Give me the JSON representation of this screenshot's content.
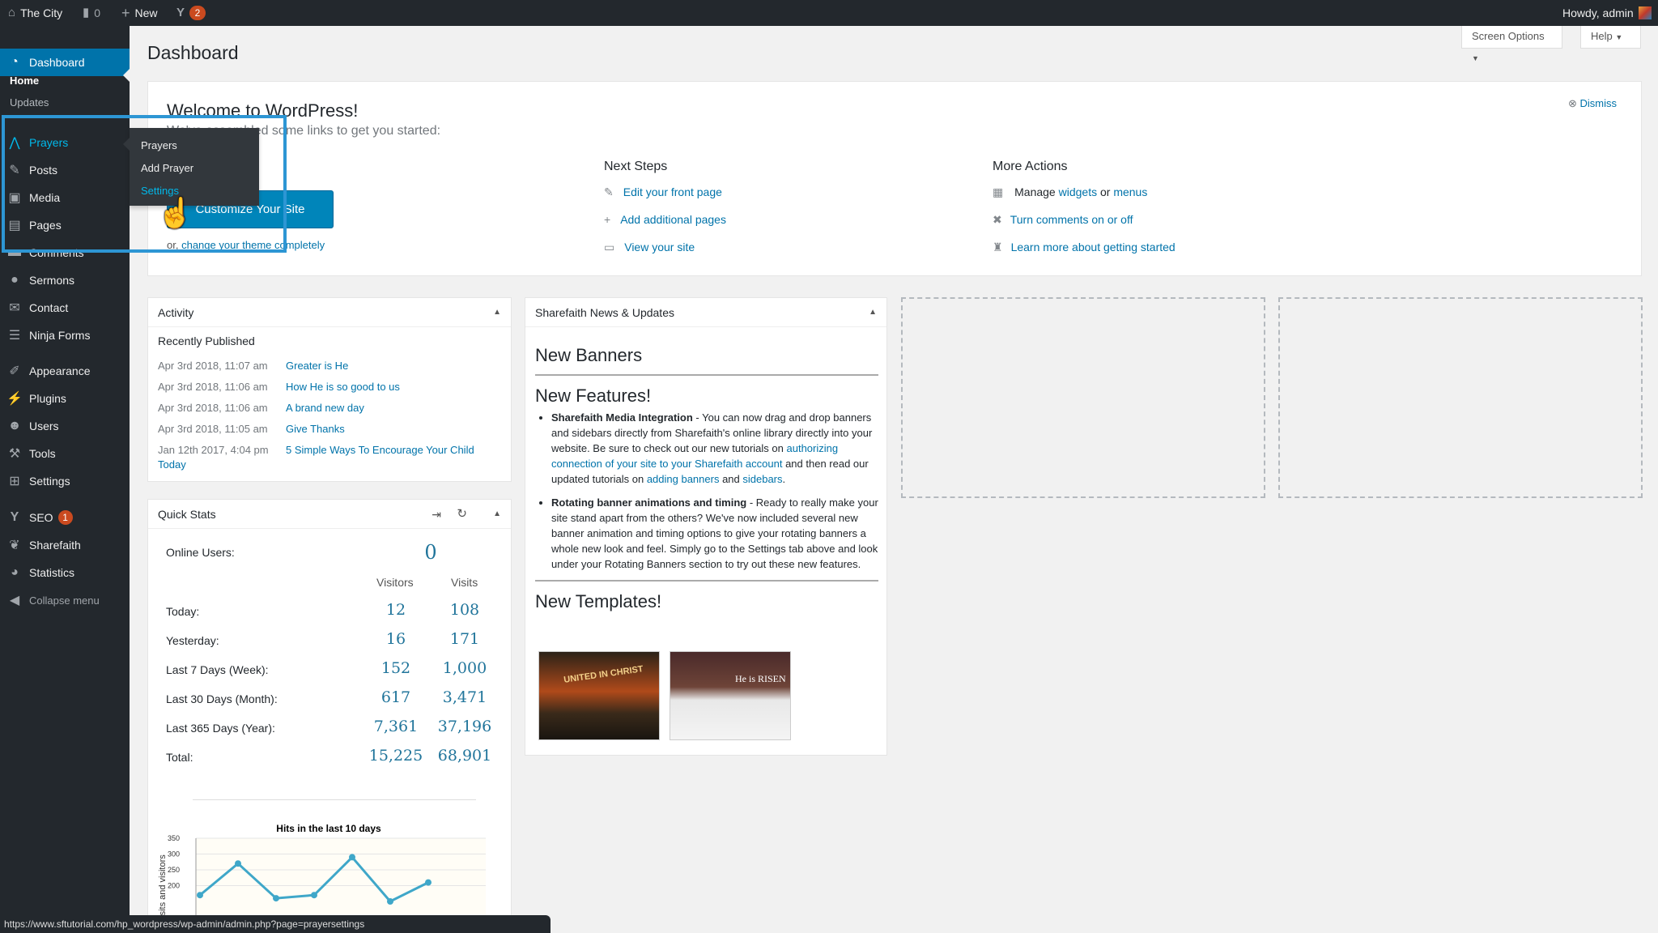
{
  "adminbar": {
    "site_name": "The City",
    "comments_count": "0",
    "new_label": "New",
    "seo_badge": "2",
    "howdy": "Howdy, admin"
  },
  "sidebar": {
    "dashboard": "Dashboard",
    "home": "Home",
    "updates": "Updates",
    "items": [
      {
        "label": "Prayers",
        "icon": "hands-icon"
      },
      {
        "label": "Posts",
        "icon": "pin-icon"
      },
      {
        "label": "Media",
        "icon": "media-icon"
      },
      {
        "label": "Pages",
        "icon": "page-icon"
      },
      {
        "label": "Comments",
        "icon": "comment-icon"
      },
      {
        "label": "Sermons",
        "icon": "sermon-icon"
      },
      {
        "label": "Contact",
        "icon": "mail-icon"
      },
      {
        "label": "Ninja Forms",
        "icon": "form-icon"
      },
      {
        "label": "Appearance",
        "icon": "brush-icon"
      },
      {
        "label": "Plugins",
        "icon": "plug-icon"
      },
      {
        "label": "Users",
        "icon": "user-icon"
      },
      {
        "label": "Tools",
        "icon": "wrench-icon"
      },
      {
        "label": "Settings",
        "icon": "settings-icon"
      },
      {
        "label": "SEO",
        "icon": "seo-icon",
        "badge": "1"
      },
      {
        "label": "Sharefaith",
        "icon": "leaf-icon"
      },
      {
        "label": "Statistics",
        "icon": "pie-icon"
      }
    ],
    "collapse": "Collapse menu"
  },
  "flyout": {
    "items": [
      "Prayers",
      "Add Prayer",
      "Settings"
    ]
  },
  "page": {
    "title": "Dashboard",
    "screen_options": "Screen Options",
    "help": "Help"
  },
  "welcome": {
    "title": "Welcome to WordPress!",
    "subtitle": "We've assembled some links to get you started:",
    "dismiss": "Dismiss",
    "customize_button": "Customize Your Site",
    "or_text": "or,",
    "change_theme": "change your theme completely",
    "next_steps_title": "Next Steps",
    "next_steps": [
      "Edit your front page",
      "Add additional pages",
      "View your site"
    ],
    "more_actions_title": "More Actions",
    "manage_prefix": "Manage",
    "widgets": "widgets",
    "or_word": "or",
    "menus": "menus",
    "comments_toggle": "Turn comments on or off",
    "learn_more": "Learn more about getting started"
  },
  "activity": {
    "title": "Activity",
    "recently_published": "Recently Published",
    "rows": [
      {
        "date": "Apr 3rd 2018, 11:07 am",
        "title": "Greater is He"
      },
      {
        "date": "Apr 3rd 2018, 11:06 am",
        "title": "How He is so good to us"
      },
      {
        "date": "Apr 3rd 2018, 11:06 am",
        "title": "A brand new day"
      },
      {
        "date": "Apr 3rd 2018, 11:05 am",
        "title": "Give Thanks"
      },
      {
        "date": "Jan 12th 2017, 4:04 pm",
        "title": "5 Simple Ways To Encourage Your Child",
        "title2": "Today"
      }
    ]
  },
  "quickstats": {
    "title": "Quick Stats",
    "online_label": "Online Users:",
    "online_value": "0",
    "col_visitors": "Visitors",
    "col_visits": "Visits",
    "rows": [
      {
        "label": "Today:",
        "visitors": "12",
        "visits": "108"
      },
      {
        "label": "Yesterday:",
        "visitors": "16",
        "visits": "171"
      },
      {
        "label": "Last 7 Days (Week):",
        "visitors": "152",
        "visits": "1,000"
      },
      {
        "label": "Last 30 Days (Month):",
        "visitors": "617",
        "visits": "3,471"
      },
      {
        "label": "Last 365 Days (Year):",
        "visitors": "7,361",
        "visits": "37,196"
      },
      {
        "label": "Total:",
        "visitors": "15,225",
        "visits": "68,901"
      }
    ]
  },
  "chart_data": {
    "type": "line",
    "title": "Hits in the last 10 days",
    "ylabel": "Visits and visitors",
    "ylim": [
      200,
      350
    ],
    "yticks": [
      "350",
      "300",
      "250",
      "200"
    ],
    "series": [
      {
        "name": "",
        "values": [
          170,
          270,
          160,
          170,
          290,
          150,
          210
        ]
      }
    ]
  },
  "news": {
    "title": "Sharefaith News & Updates",
    "banners_heading": "New Banners",
    "features_heading": "New Features!",
    "feature1_bold": "Sharefaith Media Integration",
    "feature1_text": " - You can now drag and drop banners and sidebars directly from Sharefaith's online library directly into your website. Be sure to check out our new tutorials on ",
    "feature1_link1": "authorizing connection of your site to your Sharefaith account",
    "feature1_mid": " and then read our updated tutorials on ",
    "feature1_link2": "adding banners",
    "feature1_and": " and ",
    "feature1_link3": "sidebars",
    "feature1_end": ".",
    "feature2_bold": "Rotating banner animations and timing",
    "feature2_text": " - Ready to really make your site stand apart from the others? We've now included several new banner animation and timing options to give your rotating banners a whole new look and feel. Simply go to the Settings tab above and look under your Rotating Banners section to try out these new features.",
    "templates_heading": "New Templates!",
    "thumb1_text": "UNITED IN CHRIST",
    "thumb2_text": "He is RISEN"
  },
  "statusbar": {
    "url": "https://www.sftutorial.com/hp_wordpress/wp-admin/admin.php?page=prayersettings"
  },
  "colors": {
    "accent": "#0073aa",
    "sidebar_bg": "#23282d",
    "highlight": "#2d96d4",
    "badge": "#ca4a1f"
  }
}
